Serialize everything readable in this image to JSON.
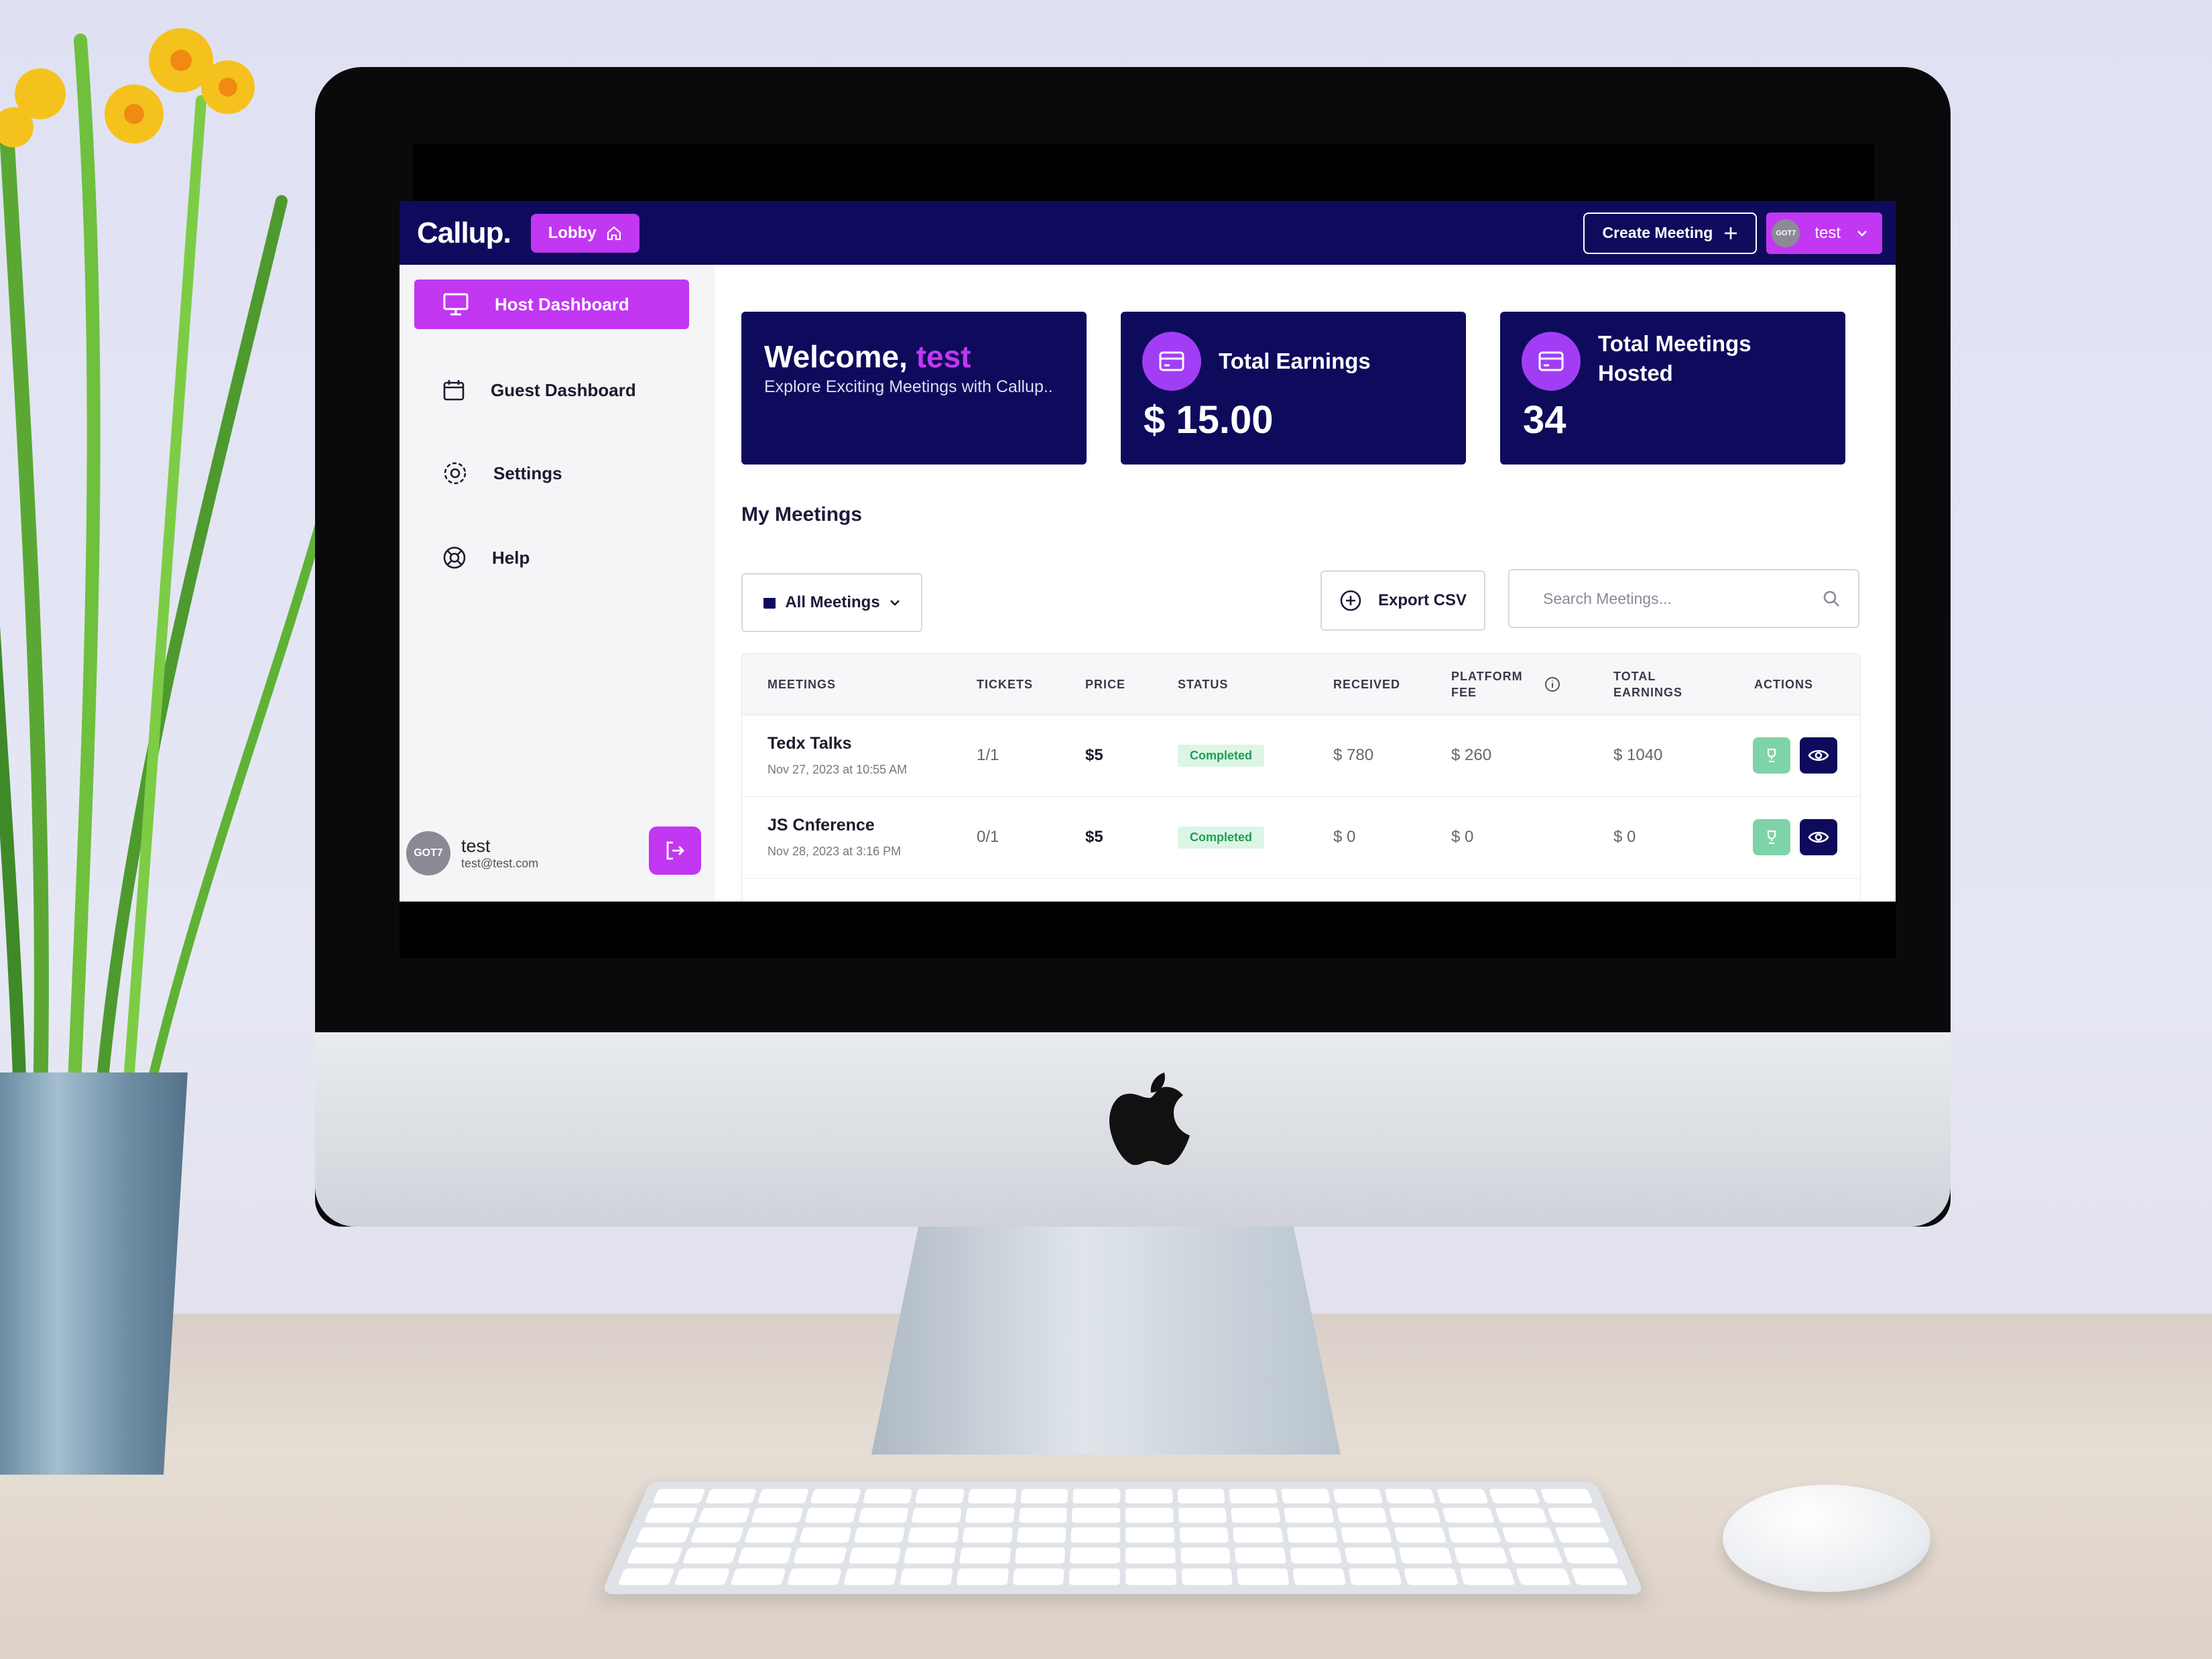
{
  "app": {
    "brand": "Callup.",
    "lobby_label": "Lobby",
    "create_meeting_label": "Create Meeting",
    "user_menu_name": "test",
    "avatar_text": "GOT7"
  },
  "sidebar": {
    "items": [
      {
        "label": "Host Dashboard",
        "icon": "monitor-icon",
        "active": true
      },
      {
        "label": "Guest Dashboard",
        "icon": "calendar-icon",
        "active": false
      },
      {
        "label": "Settings",
        "icon": "gear-icon",
        "active": false
      },
      {
        "label": "Help",
        "icon": "lifebuoy-icon",
        "active": false
      }
    ],
    "profile": {
      "name": "test",
      "email": "test@test.com",
      "avatar_text": "GOT7"
    }
  },
  "welcome": {
    "prefix": "Welcome,",
    "name": "test",
    "subtitle": "Explore Exciting Meetings with Callup.."
  },
  "stats": {
    "earnings_label": "Total Earnings",
    "earnings_value": "$ 15.00",
    "meetings_label_line1": "Total Meetings",
    "meetings_label_line2": "Hosted",
    "meetings_value": "34"
  },
  "meetings": {
    "title": "My Meetings",
    "filter_label": "All Meetings",
    "export_label": "Export CSV",
    "search_placeholder": "Search Meetings...",
    "columns": {
      "meetings": "MEETINGS",
      "tickets": "TICKETS",
      "price": "PRICE",
      "status": "STATUS",
      "received": "RECEIVED",
      "platform_fee_1": "PLATFORM",
      "platform_fee_2": "FEE",
      "total_1": "TOTAL",
      "total_2": "EARNINGS",
      "actions": "ACTIONS"
    },
    "rows": [
      {
        "title": "Tedx Talks",
        "date": "Nov 27, 2023 at 10:55 AM",
        "tickets": "1/1",
        "price": "$5",
        "status": "Completed",
        "received": "$ 780",
        "fee": "$ 260",
        "total": "$ 1040"
      },
      {
        "title": "JS Cnference",
        "date": "Nov 28, 2023 at 3:16 PM",
        "tickets": "0/1",
        "price": "$5",
        "status": "Completed",
        "received": "$ 0",
        "fee": "$ 0",
        "total": "$ 0"
      }
    ]
  },
  "colors": {
    "navy": "#0f0b5c",
    "accent": "#c237f2",
    "success": "#1f9d55"
  }
}
